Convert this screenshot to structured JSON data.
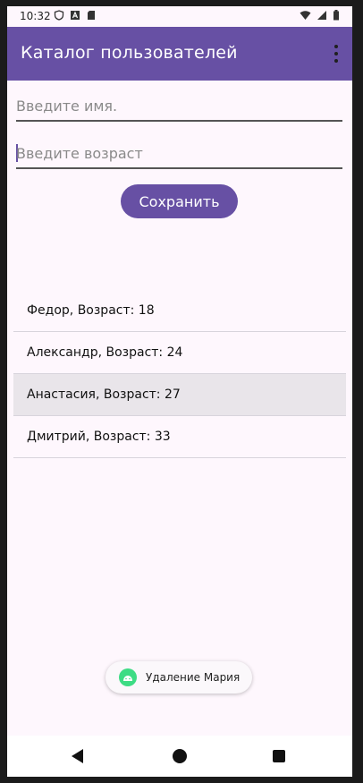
{
  "status_bar": {
    "time": "10:32",
    "left_icons": [
      "shield-icon",
      "a-badge-icon",
      "sd-card-icon"
    ],
    "right_icons": [
      "wifi-icon",
      "signal-icon",
      "battery-icon"
    ]
  },
  "app_bar": {
    "title": "Каталог пользователей",
    "menu_icon": "overflow-menu-icon"
  },
  "form": {
    "name_placeholder": "Введите имя.",
    "age_placeholder": "Введите возраст",
    "save_label": "Сохранить"
  },
  "users": [
    {
      "text": "Федор, Возраст: 18",
      "selected": false
    },
    {
      "text": "Александр, Возраст: 24",
      "selected": false
    },
    {
      "text": "Анастасия, Возраст: 27",
      "selected": true
    },
    {
      "text": "Дмитрий, Возраст: 33",
      "selected": false
    }
  ],
  "toast": {
    "text": "Удаление Мария",
    "icon": "android-icon"
  },
  "nav": {
    "back_icon": "back-icon",
    "home_icon": "home-icon",
    "recents_icon": "recents-icon"
  },
  "colors": {
    "primary": "#6750a4",
    "background": "#fef7fd",
    "selected_row": "#e9e5ea",
    "android_green": "#3ddc84"
  }
}
